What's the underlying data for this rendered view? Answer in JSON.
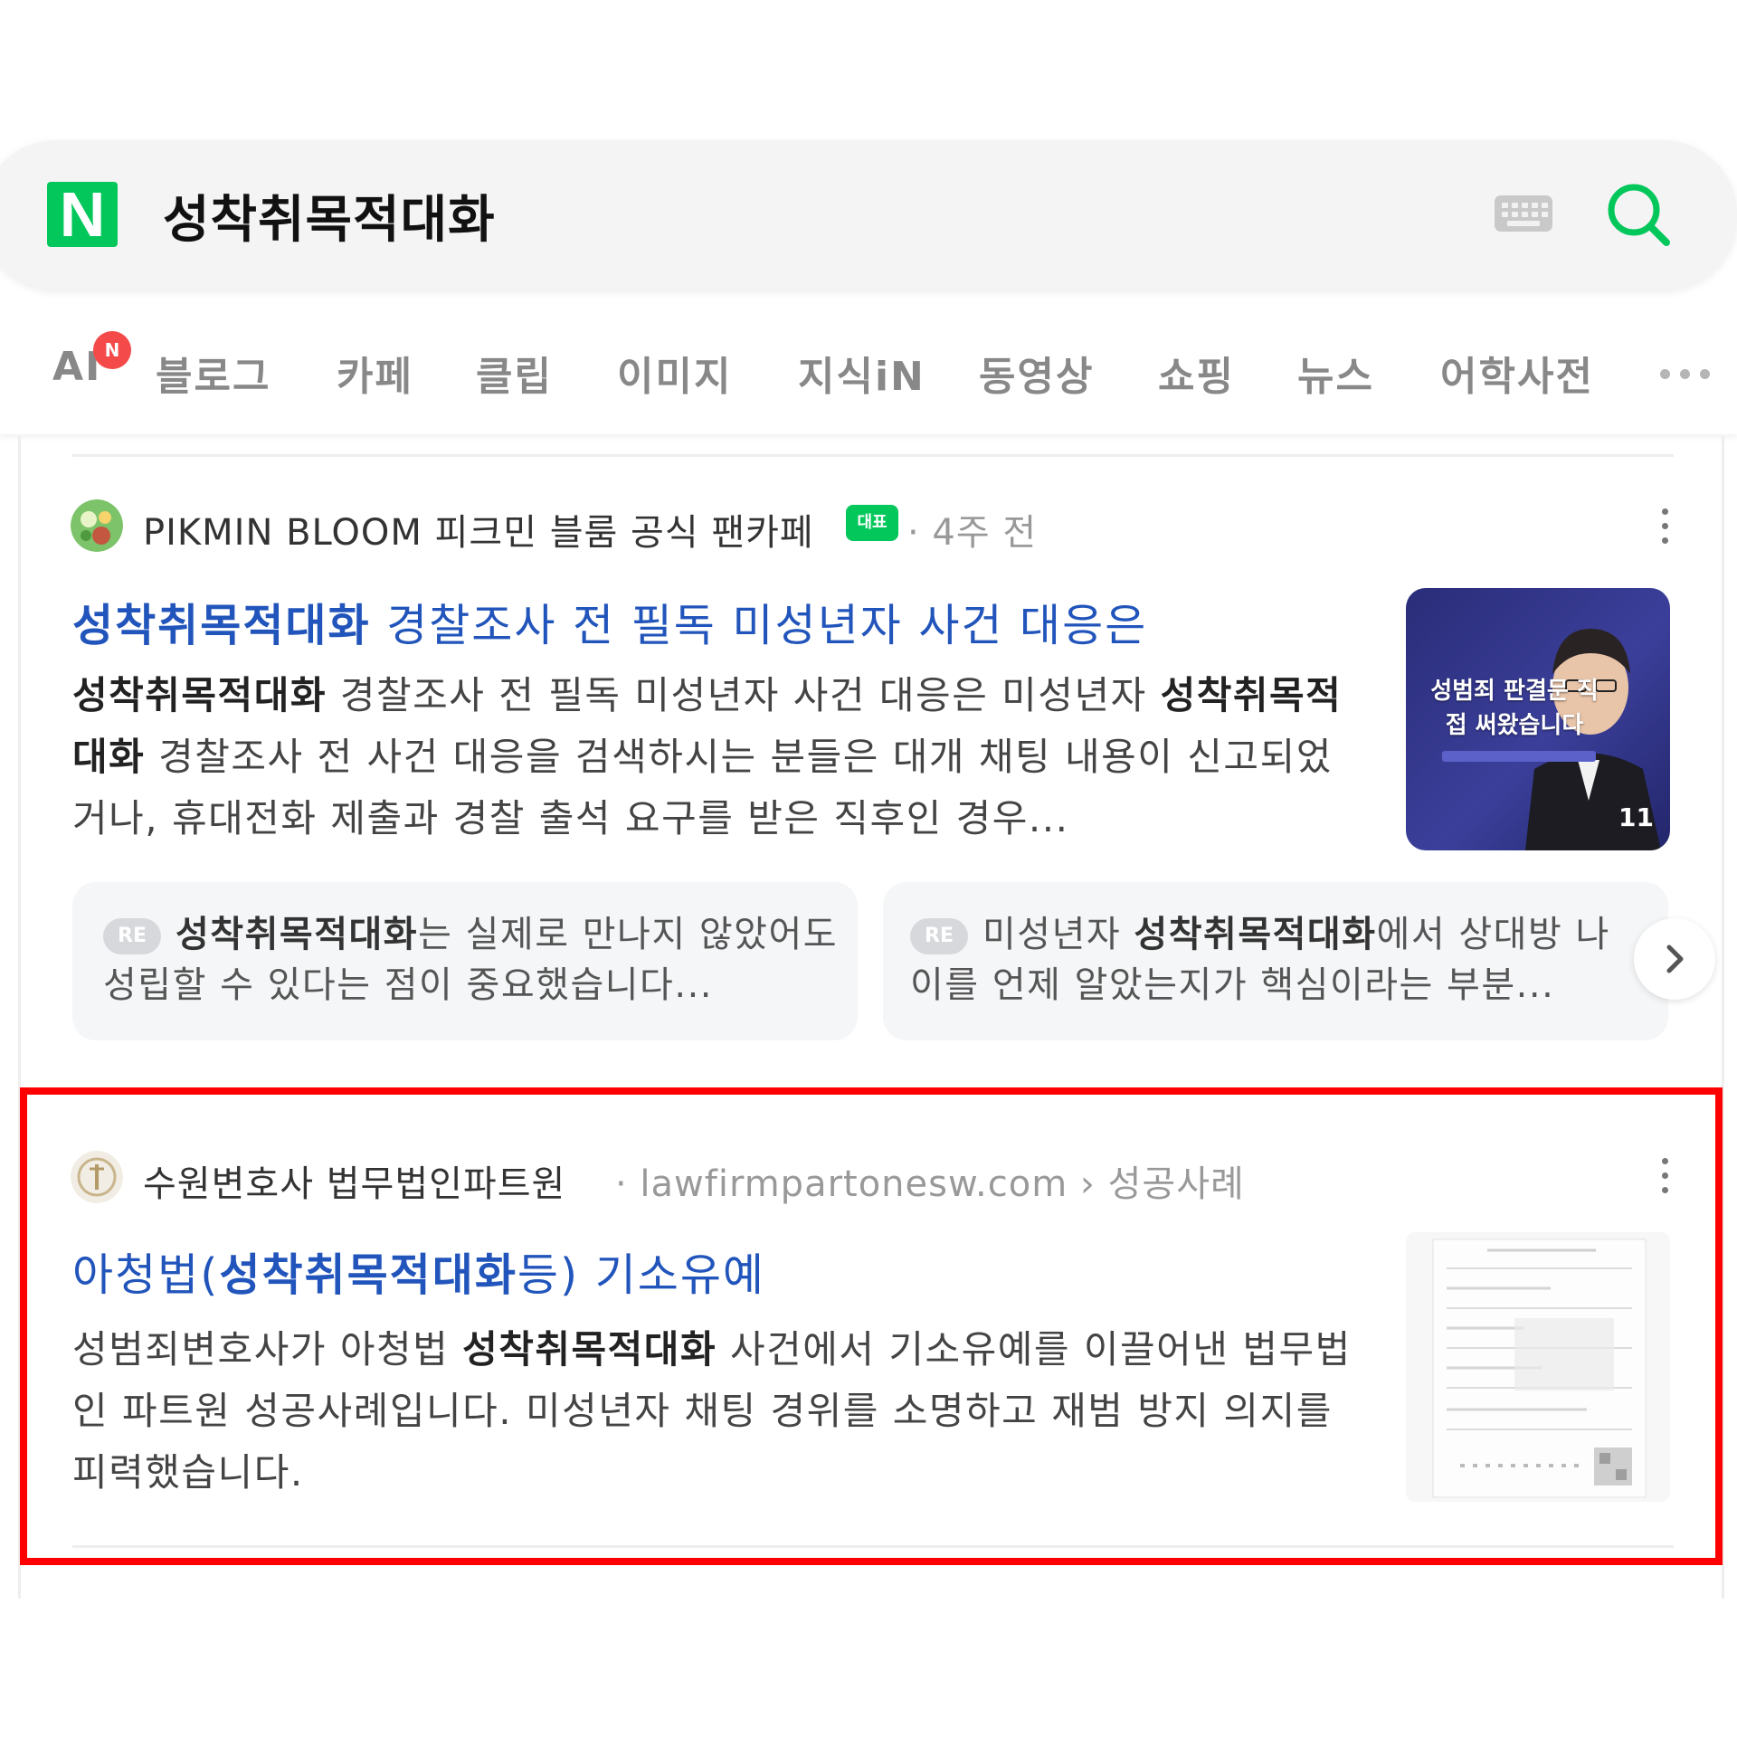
{
  "search": {
    "logo_letter": "N",
    "query": "성착취목적대화",
    "keyboard_icon": "keyboard-icon",
    "search_icon": "search-icon",
    "accent_color": "#03c75a"
  },
  "tabs": {
    "ai_label": "AI",
    "ai_badge": "N",
    "items": [
      "블로그",
      "카페",
      "클립",
      "이미지",
      "지식iN",
      "동영상",
      "쇼핑",
      "뉴스",
      "어학사전"
    ],
    "more_icon": "more-horizontal-icon"
  },
  "result1": {
    "source_name": "PIKMIN BLOOM 피크민 블룸 공식 팬카페",
    "source_badge": "대표",
    "source_time": "· 4주 전",
    "title_bold": "성착취목적대화",
    "title_rest": " 경찰조사 전 필독 미성년자 사건 대응은",
    "desc": [
      {
        "t": "성착취목적대화",
        "b": true
      },
      {
        "t": " 경찰조사 전 필독 미성년자 사건 대응은 미성년자 ",
        "b": false
      },
      {
        "t": "성착취목적대화",
        "b": true
      },
      {
        "t": " 경찰조사 전 사건 대응을 검색하시는 분들은 대개 채팅 내용이 신고되었거나, 휴대전화 제출과 경찰 출석 요구를 받은 직후인 경우...",
        "b": false
      }
    ],
    "thumb_caption": "성범죄 판결문 직접 써왔습니다",
    "thumb_count": "11",
    "replies": [
      {
        "badge": "RE",
        "parts": [
          {
            "t": "성착취목적대화",
            "b": true
          },
          {
            "t": "는 실제로 만나지 않았어도 성립할 수 있다는 점이 중요했습니다...",
            "b": false
          }
        ]
      },
      {
        "badge": "RE",
        "parts": [
          {
            "t": "미성년자 ",
            "b": false
          },
          {
            "t": "성착취목적대화",
            "b": true
          },
          {
            "t": "에서 상대방 나이를 언제 알았는지가 핵심이라는 부분...",
            "b": false
          }
        ]
      }
    ],
    "next_icon": "chevron-right-icon"
  },
  "result2": {
    "source_name": "수원변호사 법무법인파트원",
    "source_url": "· lawfirmpartonesw.com › 성공사례",
    "title_pre": "아청법(",
    "title_bold": "성착취목적대화",
    "title_post": "등) 기소유예",
    "desc": [
      {
        "t": "성범죄변호사가 아청법 ",
        "b": false
      },
      {
        "t": "성착취목적대화",
        "b": true
      },
      {
        "t": " 사건에서 기소유예를 이끌어낸 법무법인 파트원 성공사례입니다. 미성년자 채팅 경위를 소명하고 재범 방지 의지를 피력했습니다.",
        "b": false
      }
    ],
    "highlight_color": "#ff0000"
  }
}
